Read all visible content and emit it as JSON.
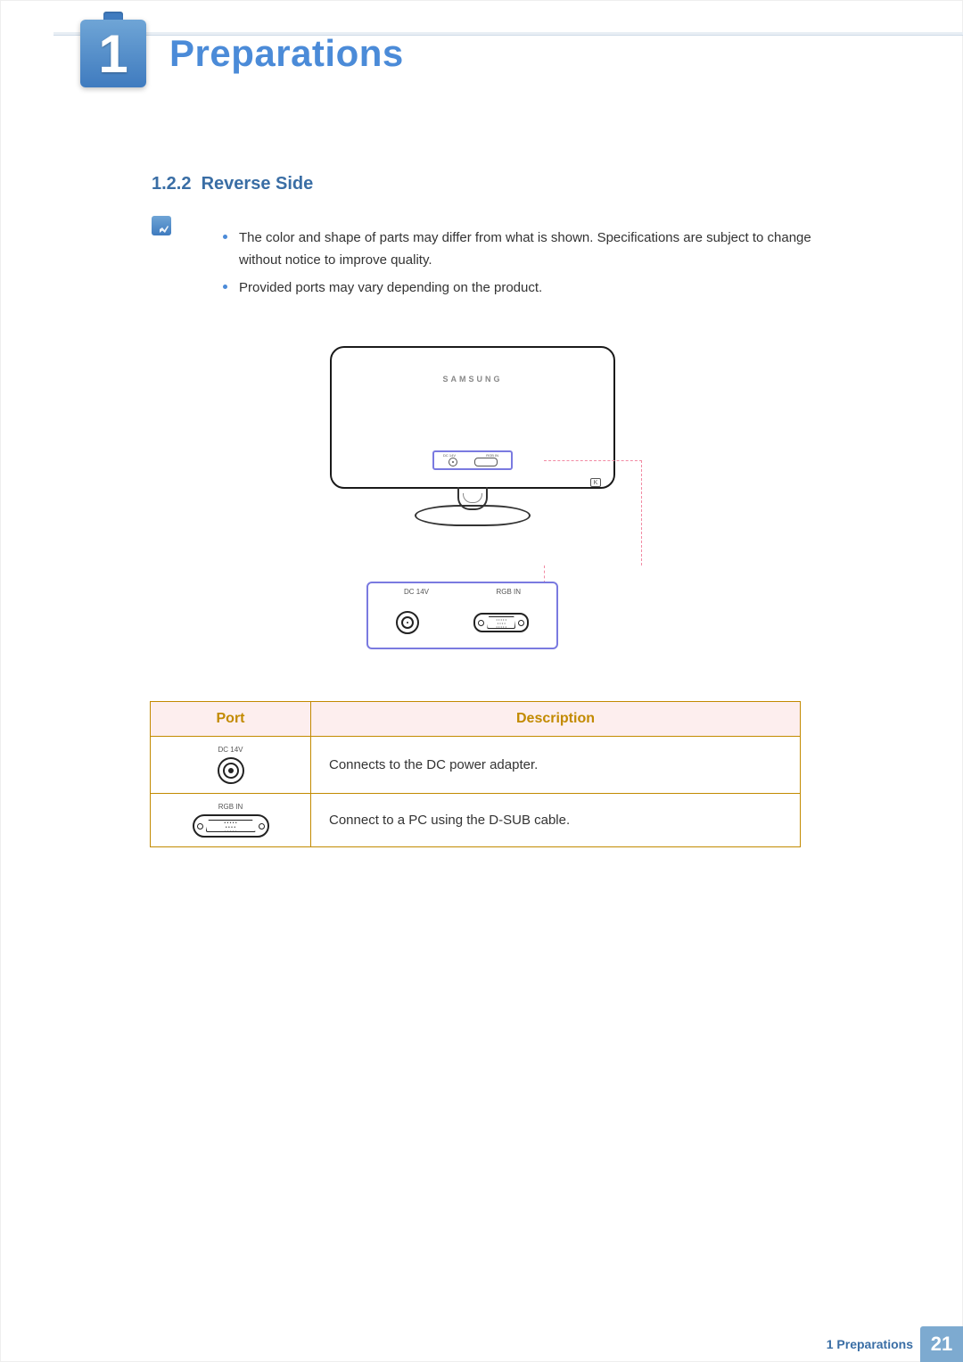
{
  "chapter": {
    "number": "1",
    "title": "Preparations"
  },
  "section": {
    "number": "1.2.2",
    "title": "Reverse Side"
  },
  "notes": [
    "The color and shape of parts may differ from what is shown. Specifications are subject to change without notice to improve quality.",
    "Provided ports may vary depending on the product."
  ],
  "diagram": {
    "brand": "SAMSUNG",
    "ports_mini": {
      "dc": "DC 14V",
      "rgb": "RGB IN"
    },
    "lock_label": "K"
  },
  "port_detail": {
    "dc_label": "DC 14V",
    "rgb_label": "RGB IN"
  },
  "table": {
    "headers": {
      "port": "Port",
      "desc": "Description"
    },
    "rows": [
      {
        "caption": "DC 14V",
        "icon": "dc",
        "desc": "Connects to the DC power adapter."
      },
      {
        "caption": "RGB IN",
        "icon": "rgb",
        "desc": "Connect to a PC using the D-SUB cable."
      }
    ]
  },
  "footer": {
    "label": "1 Preparations",
    "page": "21"
  }
}
